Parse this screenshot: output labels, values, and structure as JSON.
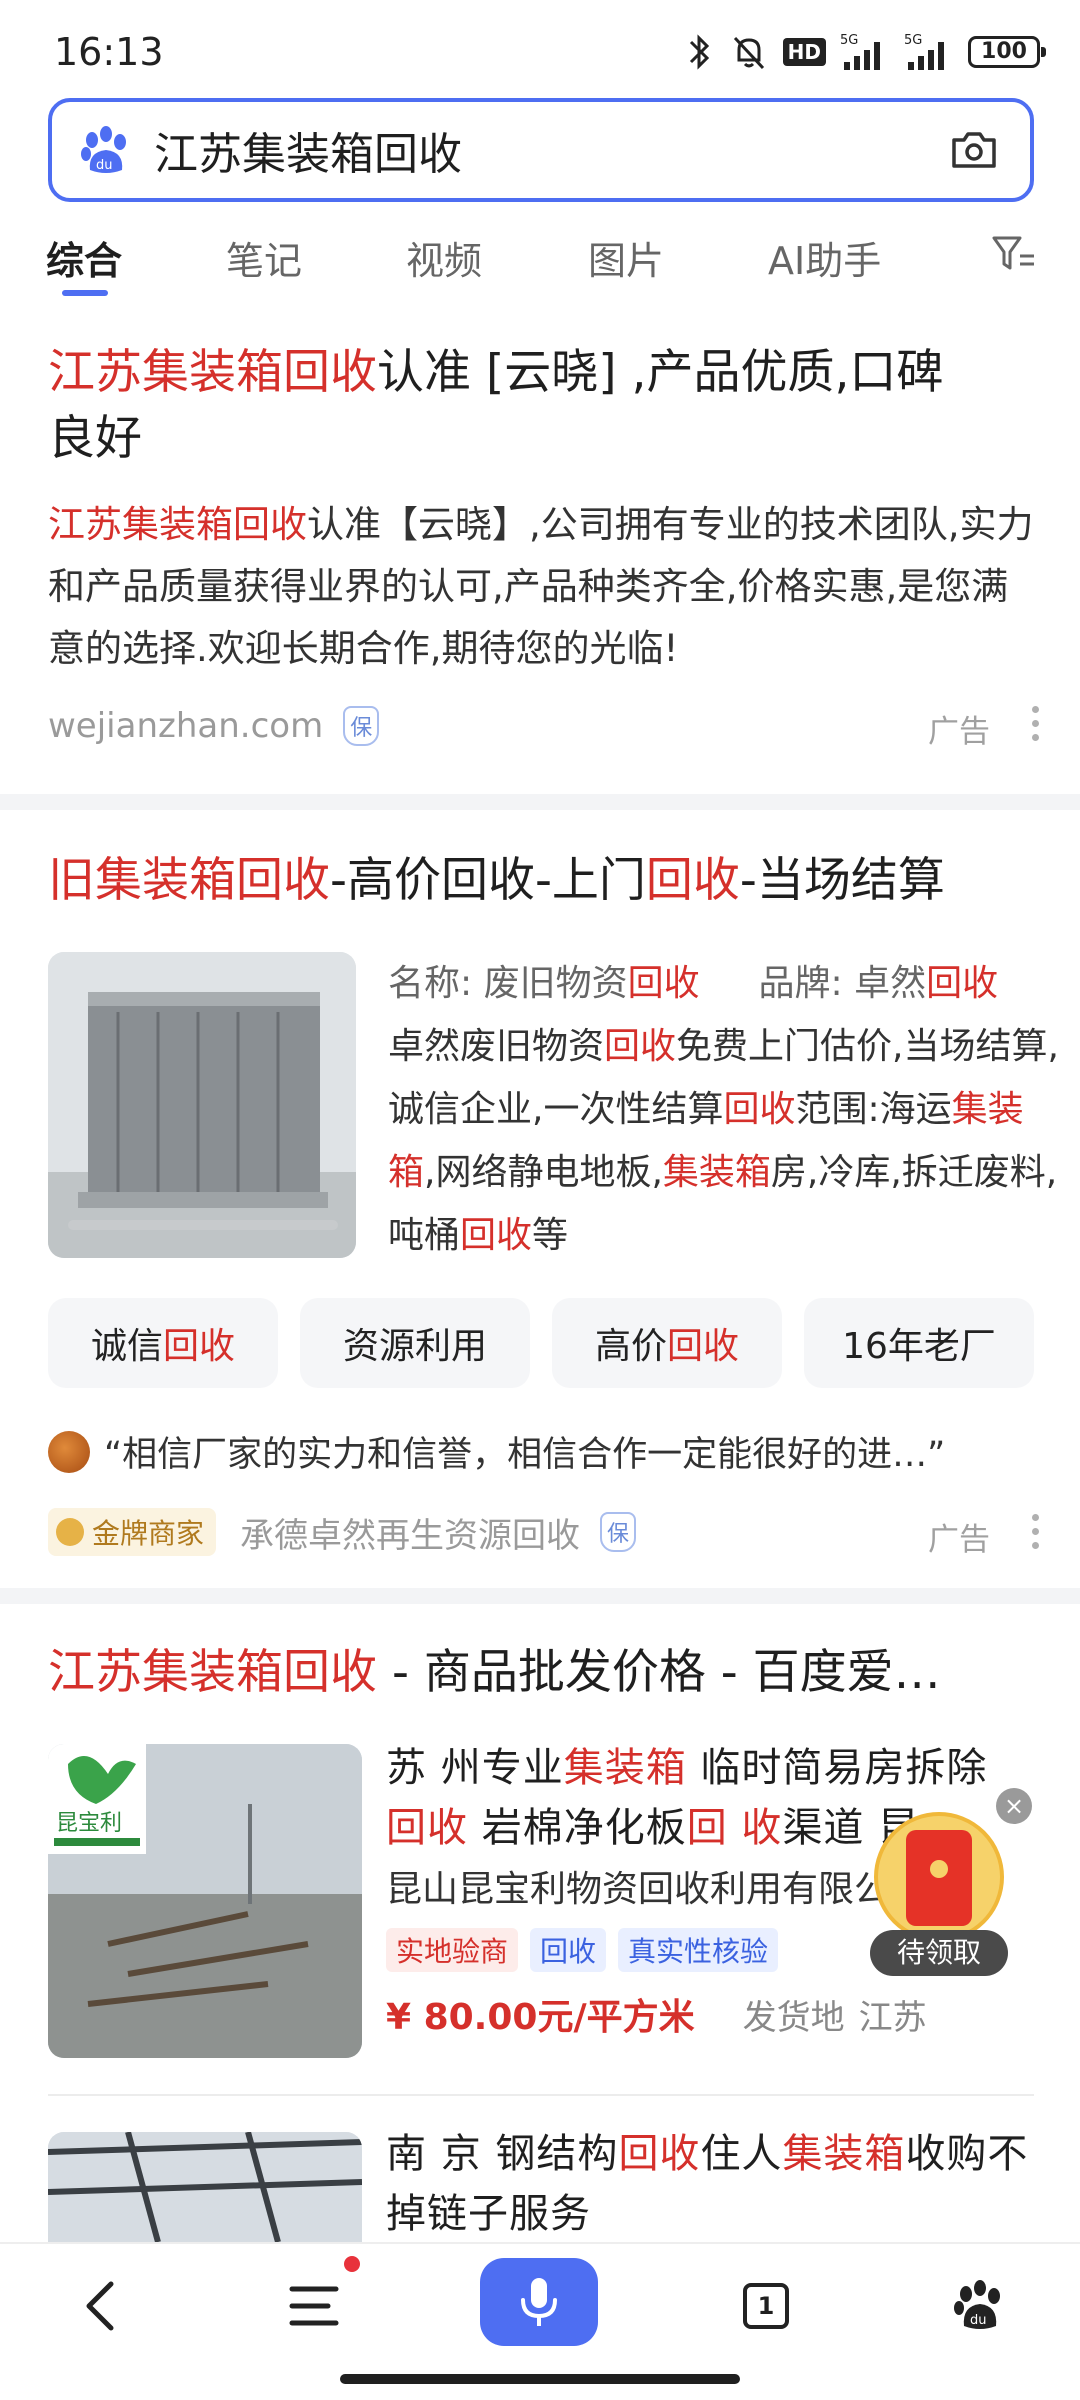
{
  "status_bar": {
    "time": "16:13",
    "battery": "100",
    "hd": "HD",
    "net1": "5G",
    "net2": "5G"
  },
  "search": {
    "query": "江苏集装箱回收"
  },
  "tabs": [
    {
      "label": "综合",
      "active": true
    },
    {
      "label": "笔记"
    },
    {
      "label": "视频"
    },
    {
      "label": "图片"
    },
    {
      "label": "AI助手"
    }
  ],
  "results": {
    "card1": {
      "title_hl": "江苏集装箱回收",
      "title_rest_1": "认准 [云晓] ,产品优质,口碑",
      "title_rest_2": "良好",
      "desc_hl": "江苏集装箱回收",
      "desc_rest": "认准【云晓】,公司拥有专业的技术团队,实力和产品质量获得业界的认可,产品种类齐全,价格实惠,是您满意的选择.欢迎长期合作,期待您的光临!",
      "domain": "wejianzhan.com",
      "shield": "保",
      "ad_label": "广告"
    },
    "card2": {
      "title_parts": [
        "旧集装箱回收",
        "-高价回收-上门",
        "回收",
        "-当场结算"
      ],
      "name_label": "名称:",
      "name_value": "废旧物资",
      "name_hl": "回收",
      "brand_label": "品牌:",
      "brand_value": "卓然",
      "brand_hl": "回收",
      "body": {
        "p1": "卓然废旧物资",
        "h1": "回收",
        "p2": "免费上门估价,当场结算,诚信企业,一次性结算",
        "h2": "回收",
        "p3": "范围:海运",
        "h3": "集装箱",
        "p4": ",网络静电地板,",
        "h4": "集装箱",
        "p5": "房,冷库,拆迁废料,吨桶",
        "h5": "回收",
        "p6": "等"
      },
      "tags": [
        {
          "plain": "诚信",
          "hl": "回收"
        },
        {
          "plain": "资源利用",
          "hl": ""
        },
        {
          "plain": "高价",
          "hl": "回收"
        },
        {
          "plain": "16年老厂",
          "hl": ""
        }
      ],
      "quote": "“相信厂家的实力和信誉，相信合作一定能很好的进…”",
      "badge": "金牌商家",
      "merchant": "承德卓然再生资源回收",
      "shield": "保",
      "ad_label": "广告"
    },
    "card3": {
      "title_hl": "江苏集装箱回收",
      "title_rest": " - 商品批发价格 - 百度爱…",
      "img_brand": "昆宝利",
      "line1_a": "苏 州专业",
      "line1_hl": "集装箱",
      "line1_b": " 临时简易房拆除",
      "line2_hl1": "回收",
      "line2_a": " 岩棉净化板",
      "line2_hl2": "回 收",
      "line2_b": "渠道 昆",
      "company": "昆山昆宝利物资回收利用有限公",
      "tags": [
        "实地验商",
        "回收",
        "真实性核验"
      ],
      "price": "¥ 80.00元/平方米",
      "ship_label": "发货地",
      "ship_value": "江苏"
    },
    "card4": {
      "a": "南 京 钢结构",
      "hl1": "回收",
      "b": "住人",
      "hl2": "集装箱",
      "c": "收购不掉链子服务"
    }
  },
  "redpack": {
    "label": "待领取",
    "close": "×"
  },
  "bottom_nav": {
    "tabs_count": "1"
  }
}
